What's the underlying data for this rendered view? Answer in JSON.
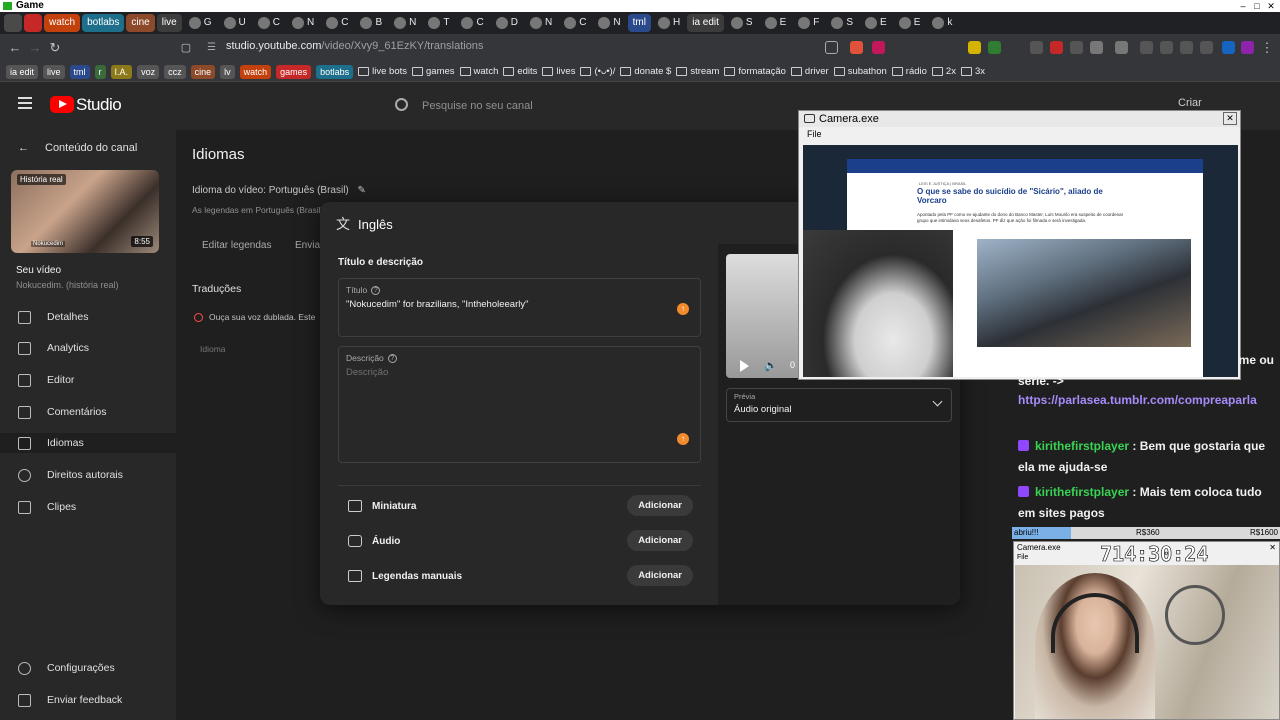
{
  "window": {
    "title": "Game",
    "controls": [
      "–",
      "□",
      "✕"
    ]
  },
  "tabs": [
    {
      "label": "",
      "color": "#4a4a4a"
    },
    {
      "label": "",
      "color": "#c62828"
    },
    {
      "label": "watch",
      "color": "#c2410c"
    },
    {
      "label": "botlabs",
      "color": "#1e6f8c"
    },
    {
      "label": "cine",
      "color": "#8c4a2a"
    },
    {
      "label": "live",
      "color": "#3c3c3c"
    },
    {
      "label": "G",
      "color": ""
    },
    {
      "label": "U",
      "color": ""
    },
    {
      "label": "C",
      "color": ""
    },
    {
      "label": "N",
      "color": ""
    },
    {
      "label": "C",
      "color": ""
    },
    {
      "label": "B",
      "color": ""
    },
    {
      "label": "N",
      "color": ""
    },
    {
      "label": "T",
      "color": ""
    },
    {
      "label": "C",
      "color": ""
    },
    {
      "label": "D",
      "color": ""
    },
    {
      "label": "N",
      "color": ""
    },
    {
      "label": "C",
      "color": ""
    },
    {
      "label": "N",
      "color": ""
    },
    {
      "label": "tml",
      "color": "#2b4a8c"
    },
    {
      "label": "H",
      "color": ""
    },
    {
      "label": "ia edit",
      "color": "#3c3c3c"
    },
    {
      "label": "S",
      "color": ""
    },
    {
      "label": "E",
      "color": ""
    },
    {
      "label": "F",
      "color": ""
    },
    {
      "label": "S",
      "color": ""
    },
    {
      "label": "E",
      "color": ""
    },
    {
      "label": "E",
      "color": ""
    },
    {
      "label": "k",
      "color": ""
    }
  ],
  "address": {
    "url_host": "studio.youtube.com",
    "url_path": "/video/Xvy9_61EzKY/translations"
  },
  "bookmarks": {
    "chips": [
      {
        "label": "ia edit",
        "color": "#555"
      },
      {
        "label": "live",
        "color": "#555"
      },
      {
        "label": "tml",
        "color": "#2b4a8c"
      },
      {
        "label": "r",
        "color": "#3b6b3b"
      },
      {
        "label": "I.A.",
        "color": "#8c7a1a"
      },
      {
        "label": "voz",
        "color": "#555"
      },
      {
        "label": "ccz",
        "color": "#555"
      },
      {
        "label": "cine",
        "color": "#8c4a2a"
      },
      {
        "label": "lv",
        "color": "#555"
      },
      {
        "label": "watch",
        "color": "#c2410c"
      },
      {
        "label": "games",
        "color": "#c62828"
      },
      {
        "label": "botlabs",
        "color": "#1e6f8c"
      }
    ],
    "items": [
      "live bots",
      "games",
      "watch",
      "edits",
      "lives",
      "(•ᴗ•)/",
      "donate $",
      "stream",
      "formatação",
      "driver",
      "subathon",
      "rádio",
      "2x",
      "3x"
    ]
  },
  "studio": {
    "brand": "Studio",
    "search_placeholder": "Pesquise no seu canal",
    "create_label": "Criar"
  },
  "sidebar": {
    "back_label": "Conteúdo do canal",
    "thumb_badge": "História real",
    "thumb_name": "Nokucedim",
    "thumb_duration": "8:55",
    "your_video": "Seu vídeo",
    "video_title": "Nokucedim. (história real)",
    "items": [
      {
        "label": "Detalhes"
      },
      {
        "label": "Analytics"
      },
      {
        "label": "Editor"
      },
      {
        "label": "Comentários"
      },
      {
        "label": "Idiomas"
      },
      {
        "label": "Direitos autorais"
      },
      {
        "label": "Clipes"
      }
    ],
    "settings": "Configurações",
    "feedback": "Enviar feedback"
  },
  "page": {
    "title": "Idiomas",
    "video_language": "Idioma do vídeo: Português (Brasil)",
    "subs_note": "As legendas em Português (Brasil)",
    "edit_subtitles": "Editar legendas",
    "send": "Enviar",
    "translations_heading": "Traduções",
    "dub_notice": "Ouça sua voz dublada. Este",
    "idioma_col": "Idioma"
  },
  "modal": {
    "language": "Inglês",
    "section_title": "Título e descrição",
    "title_label": "Título",
    "title_value": "\"Nokucedim\" for brazilians, \"Intheholeearly\"",
    "desc_label": "Descrição",
    "desc_placeholder": "Descrição",
    "rows": [
      {
        "label": "Miniatura",
        "button": "Adicionar"
      },
      {
        "label": "Áudio",
        "button": "Adicionar"
      },
      {
        "label": "Legendas manuais",
        "button": "Adicionar"
      }
    ],
    "preview_label": "Prévia",
    "preview_value": "Áudio original",
    "time_fragment": "0"
  },
  "camera1": {
    "title": "Camera.exe",
    "menu": "File",
    "article_kicker": "LEIS E JUSTIÇA | BRASIL",
    "article_title": "O que se sabe do suicídio de \"Sicário\", aliado de Vorcaro",
    "article_lead": "Apontado pela PF como ex-ajudante do dono do Banco Master, Luís Mourilo era suspeito de coordenar grupo que intimidava seus desafetos. PF diz que ação foi filmada e será investigada."
  },
  "chat": {
    "lines": [
      {
        "type": "text",
        "text": "me ou"
      },
      {
        "type": "text",
        "text": "serie. ->"
      },
      {
        "type": "link",
        "text": "https://parlasea.tumblr.com/compreaparla"
      },
      {
        "type": "user",
        "user": "kirithefirstplayer",
        "text": "Bem que gostaria que ela me ajuda-se"
      },
      {
        "type": "user",
        "user": "kirithefirstplayer",
        "text": "Mais tem coloca tudo em sites pagos"
      }
    ]
  },
  "goal": {
    "label": "abriu!!!",
    "mid": "R$360",
    "right": "R$1600",
    "progress": 0.22
  },
  "camera2": {
    "title": "Camera.exe",
    "menu": "File",
    "timer": "714:30:24"
  }
}
